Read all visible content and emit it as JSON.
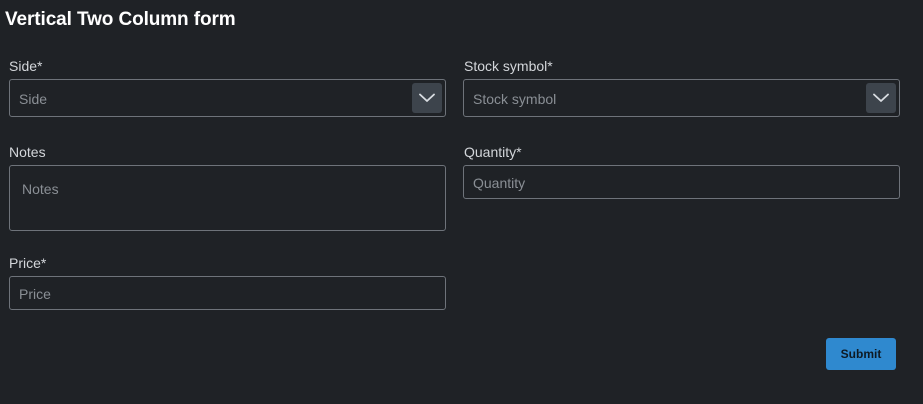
{
  "form": {
    "title": "Vertical Two Column form",
    "fields": {
      "side": {
        "label": "Side*",
        "placeholder": "Side",
        "icon": "chevron-down-icon"
      },
      "stock_symbol": {
        "label": "Stock symbol*",
        "placeholder": "Stock symbol",
        "icon": "chevron-down-icon"
      },
      "notes": {
        "label": "Notes",
        "placeholder": "Notes"
      },
      "quantity": {
        "label": "Quantity*",
        "placeholder": "Quantity"
      },
      "price": {
        "label": "Price*",
        "placeholder": "Price"
      }
    },
    "submit_label": "Submit"
  },
  "colors": {
    "background": "#1f2226",
    "border": "#6e737a",
    "dropdown_button": "#3d444c",
    "accent": "#2f89cf"
  }
}
